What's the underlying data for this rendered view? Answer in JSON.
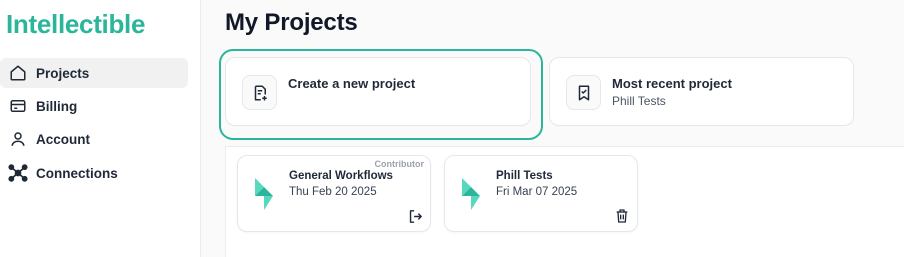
{
  "brand": {
    "name": "Intellectible",
    "color": "#2bb59a"
  },
  "sidebar": {
    "items": [
      {
        "label": "Projects",
        "icon": "home-icon",
        "active": true
      },
      {
        "label": "Billing",
        "icon": "credit-card-icon",
        "active": false
      },
      {
        "label": "Account",
        "icon": "user-icon",
        "active": false
      },
      {
        "label": "Connections",
        "icon": "network-icon",
        "active": false
      }
    ]
  },
  "page": {
    "title": "My Projects"
  },
  "actions": {
    "create": {
      "title": "Create a new project",
      "icon": "new-document-icon"
    },
    "recent": {
      "title": "Most recent project",
      "subtitle": "Phill Tests",
      "icon": "bookmark-check-icon"
    }
  },
  "projects": [
    {
      "name": "General Workflows",
      "date": "Thu Feb 20 2025",
      "role": "Contributor",
      "action_icon": "leave-icon"
    },
    {
      "name": "Phill Tests",
      "date": "Fri Mar 07 2025",
      "role": "",
      "action_icon": "trash-icon"
    }
  ]
}
